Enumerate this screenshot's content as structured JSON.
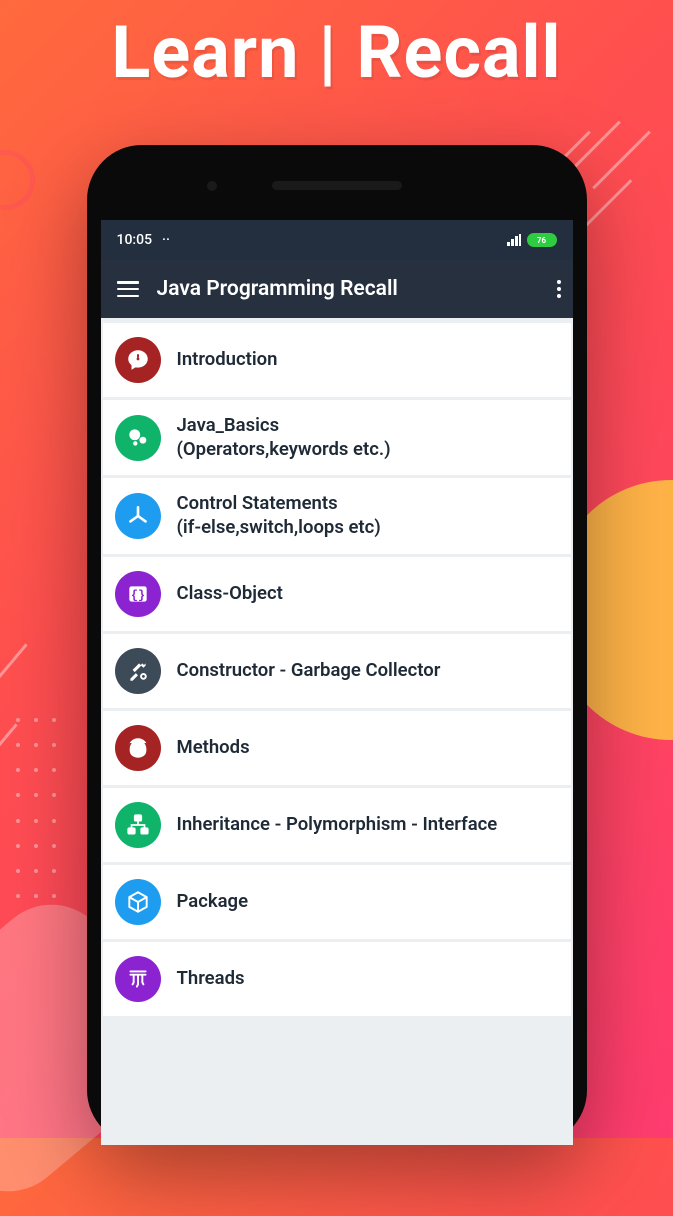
{
  "headline": "Learn | Recall",
  "statusbar": {
    "time": "10:05",
    "battery_pct": "76"
  },
  "appbar": {
    "title": "Java Programming Recall"
  },
  "items": [
    {
      "title": "Introduction",
      "subtitle": "",
      "icon": "speech-exclaim",
      "color": "#a62324"
    },
    {
      "title": "Java_Basics",
      "subtitle": "(Operators,keywords etc.)",
      "icon": "bubbles",
      "color": "#0fb36a"
    },
    {
      "title": "Control Statements",
      "subtitle": "(if-else,switch,loops etc)",
      "icon": "fan",
      "color": "#1e9cf0"
    },
    {
      "title": "Class-Object",
      "subtitle": "",
      "icon": "braces-box",
      "color": "#8b23d1"
    },
    {
      "title": "Constructor - Garbage Collector",
      "subtitle": "",
      "icon": "tools",
      "color": "#3d4a58"
    },
    {
      "title": "Methods",
      "subtitle": "",
      "icon": "parens",
      "color": "#a62324"
    },
    {
      "title": "Inheritance - Polymorphism - Interface",
      "subtitle": "",
      "icon": "hierarchy",
      "color": "#0fb36a"
    },
    {
      "title": "Package",
      "subtitle": "",
      "icon": "cube",
      "color": "#1e9cf0"
    },
    {
      "title": "Threads",
      "subtitle": "",
      "icon": "threads",
      "color": "#8b23d1"
    }
  ]
}
